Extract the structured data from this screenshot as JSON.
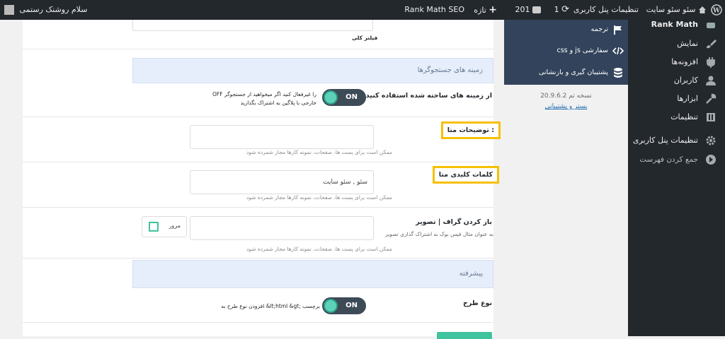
{
  "adminbar": {
    "site_name": "سئو سئو سایت",
    "customize": "تنظیمات پنل کاربری",
    "updates_count": "1",
    "comments_count": "201",
    "new_label": "تازه",
    "rankmath_label": "Rank Math SEO",
    "greeting": "سلام روشنک رستمی",
    "wp_icon": "wordpress-icon",
    "home_icon": "home-icon"
  },
  "panel": {
    "top_textarea_hint": "فیلتر کلی",
    "band1_title": "زمینه های جستجوگرها",
    "toggle1_label": "از زمینه های ساخته شده استفاده کنید",
    "toggle1_state": "ON",
    "toggle1_desc": "OFF را غیرفعال کنید اگر میخواهید از جستجوگر خارجی با پلاگین به اشتراک بگذارید",
    "meta_desc_label": "توضیحات متا :",
    "meta_desc_value": "",
    "meta_desc_hint": "ممکن است برای پست ها، صفحات، نمونه کارها مجاز شمرده شود",
    "meta_kw_label": "کلمات کلیدی متا",
    "meta_kw_value": "سئو , سئو سایت",
    "meta_kw_hint": "ممکن است برای پست ها، صفحات، نمونه کارها مجاز شمرده شود",
    "og_label": "باز کردن گراف | تصویر",
    "og_desc": "به عنوان مثال فیس بوک به اشتراک گذاری تصویر",
    "og_value": "",
    "og_hint": "ممکن است برای پست ها، صفحات، نمونه کارها مجاز شمرده شود",
    "browse_label": "مرور",
    "band2_title": "پیشرفته",
    "toggle2_label": "نوع طرح",
    "toggle2_state": "ON",
    "toggle2_desc": "افزودن نوع طرح به &lt;html &gt; برچسب"
  },
  "rankmath_menu": {
    "header": "Rank Math",
    "items": [
      {
        "label": "ترجمه",
        "icon": "flag-icon"
      },
      {
        "label": "css و js سفارشی",
        "icon": "code-icon"
      },
      {
        "label": "پشتیبان گیری و بازنشانی",
        "icon": "database-icon"
      }
    ],
    "version": "نسخه تم 20.9.6.2",
    "version_link": "بستر و پشتیبانی"
  },
  "adminmenu": {
    "items": [
      {
        "label": "نمایش",
        "icon": "paintbrush-icon"
      },
      {
        "label": "افزونه‌ها",
        "icon": "plugin-icon"
      },
      {
        "label": "کاربران",
        "icon": "users-icon"
      },
      {
        "label": "ابزارها",
        "icon": "wrench-icon"
      },
      {
        "label": "تنظیمات",
        "icon": "settings-icon"
      },
      {
        "label": "تنظیمات پنل کاربری",
        "icon": "gear-icon"
      },
      {
        "label": "جمع کردن فهرست",
        "icon": "collapse-icon"
      }
    ]
  },
  "colors": {
    "adminbar_bg": "#23282d",
    "rankmath_panel_bg": "#32435b",
    "highlight": "#f6c000",
    "toggle_knob": "#5cd3b8",
    "band_bg": "#e6eefb"
  }
}
